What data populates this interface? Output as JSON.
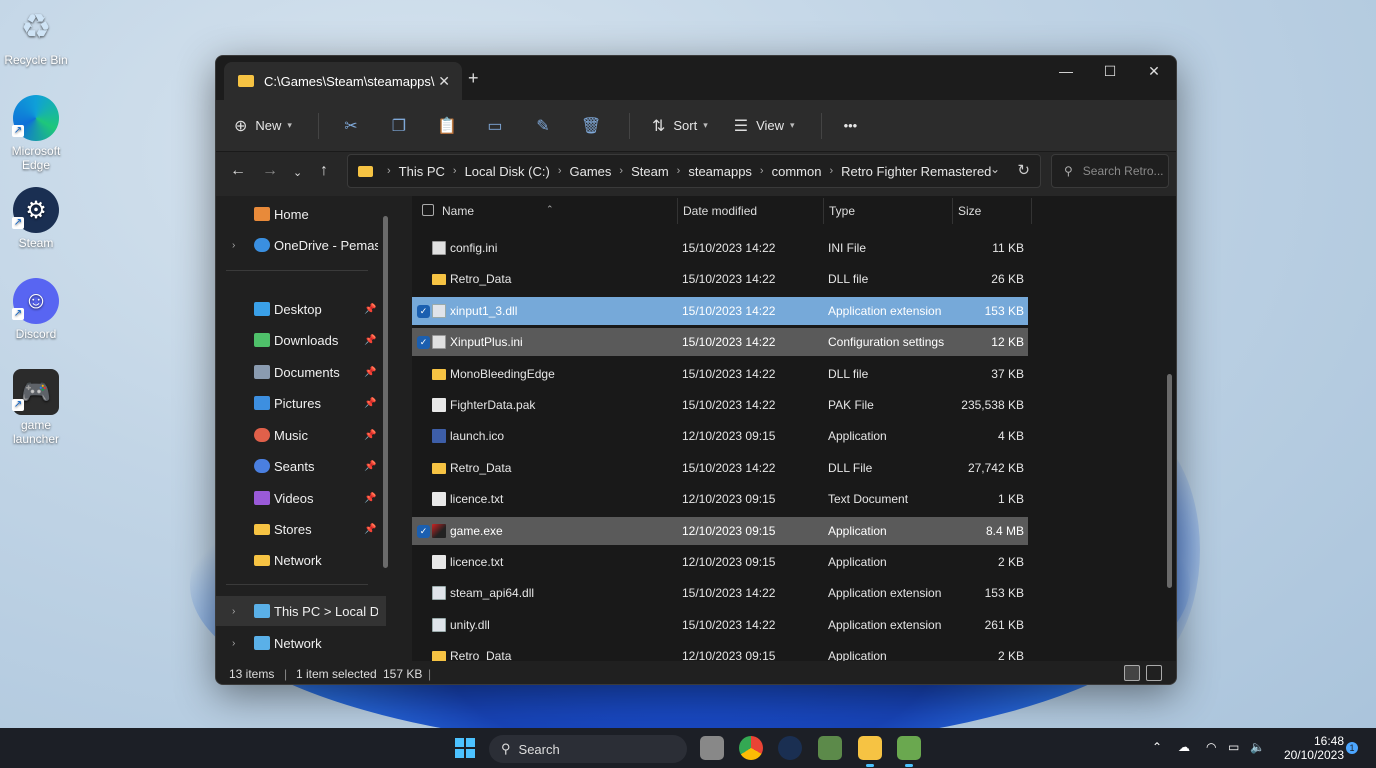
{
  "desktop": {
    "icons": [
      {
        "label": "Recycle Bin",
        "icon": "recycle-bin-icon"
      },
      {
        "label": "Microsoft Edge",
        "icon": "edge-icon"
      },
      {
        "label": "Steam",
        "icon": "steam-icon"
      },
      {
        "label": "Discord",
        "icon": "discord-icon"
      },
      {
        "label": "game launcher",
        "icon": "game-controller-icon"
      }
    ]
  },
  "window": {
    "tab_title": "C:\\Games\\Steam\\steamapps\\",
    "toolbar": {
      "new_label": "New",
      "sort_label": "Sort",
      "view_label": "View",
      "more_label": "•••"
    },
    "breadcrumb": [
      "This PC",
      "Local Disk (C:)",
      "Games",
      "Steam",
      "steamapps",
      "common",
      "Retro Fighter Remastered"
    ],
    "search_placeholder": "Search Retro...",
    "sidebar": {
      "home": "Home",
      "onedrive": "OneDrive - Pemasts",
      "quick": [
        {
          "label": "Desktop",
          "color": "#3aa0e8"
        },
        {
          "label": "Downloads",
          "color": "#4fc06a"
        },
        {
          "label": "Documents",
          "color": "#8a9bb0"
        },
        {
          "label": "Pictures",
          "color": "#3d8fe0"
        },
        {
          "label": "Music",
          "color": "#e0604a"
        },
        {
          "label": "Seants",
          "color": "#4a7fe0"
        },
        {
          "label": "Videos",
          "color": "#9a5ad8"
        },
        {
          "label": "Stores",
          "color": "#f6c343"
        },
        {
          "label": "Network",
          "color": "#f6c343"
        }
      ],
      "thispc": "This PC > Local Disk",
      "network": "Network"
    },
    "columns": {
      "name": "Name",
      "date": "Date modified",
      "type": "Type",
      "size": "Size"
    },
    "files": [
      {
        "name": "config.ini",
        "date": "15/10/2023 14:22",
        "type": "INI File",
        "size": "11 KB",
        "kind": "ini",
        "state": ""
      },
      {
        "name": "Retro_Data",
        "date": "15/10/2023 14:22",
        "type": "DLL file",
        "size": "26 KB",
        "kind": "folder",
        "state": ""
      },
      {
        "name": "xinput1_3.dll",
        "date": "15/10/2023 14:22",
        "type": "Application extension",
        "size": "153 KB",
        "kind": "dll",
        "state": "blue"
      },
      {
        "name": "XinputPlus.ini",
        "date": "15/10/2023 14:22",
        "type": "Configuration settings",
        "size": "12 KB",
        "kind": "ini",
        "state": "grey"
      },
      {
        "name": "MonoBleedingEdge",
        "date": "15/10/2023 14:22",
        "type": "DLL file",
        "size": "37 KB",
        "kind": "folder",
        "state": ""
      },
      {
        "name": "FighterData.pak",
        "date": "15/10/2023 14:22",
        "type": "PAK File",
        "size": "235,538 KB",
        "kind": "doc",
        "state": ""
      },
      {
        "name": "launch.ico",
        "date": "12/10/2023 09:15",
        "type": "Application",
        "size": "4 KB",
        "kind": "ico",
        "state": ""
      },
      {
        "name": "Retro_Data",
        "date": "15/10/2023 14:22",
        "type": "DLL File",
        "size": "27,742 KB",
        "kind": "folder",
        "state": ""
      },
      {
        "name": "licence.txt",
        "date": "12/10/2023 09:15",
        "type": "Text Document",
        "size": "1 KB",
        "kind": "doc",
        "state": ""
      },
      {
        "name": "game.exe",
        "date": "12/10/2023 09:15",
        "type": "Application",
        "size": "8.4 MB",
        "kind": "app",
        "state": "grey"
      },
      {
        "name": "licence.txt",
        "date": "12/10/2023 09:15",
        "type": "Application",
        "size": "2 KB",
        "kind": "doc",
        "state": ""
      },
      {
        "name": "steam_api64.dll",
        "date": "15/10/2023 14:22",
        "type": "Application extension",
        "size": "153 KB",
        "kind": "dll",
        "state": ""
      },
      {
        "name": "unity.dll",
        "date": "15/10/2023 14:22",
        "type": "Application extension",
        "size": "261 KB",
        "kind": "dll",
        "state": ""
      },
      {
        "name": "Retro_Data",
        "date": "12/10/2023 09:15",
        "type": "Application",
        "size": "2 KB",
        "kind": "folder",
        "state": ""
      }
    ],
    "status": {
      "items": "13 items",
      "selected": "1 item selected",
      "size": "157 KB"
    }
  },
  "taskbar": {
    "search_label": "Search",
    "time": "16:48",
    "date": "20/10/2023",
    "notification_count": "1",
    "accent": "#4cc2ff"
  }
}
